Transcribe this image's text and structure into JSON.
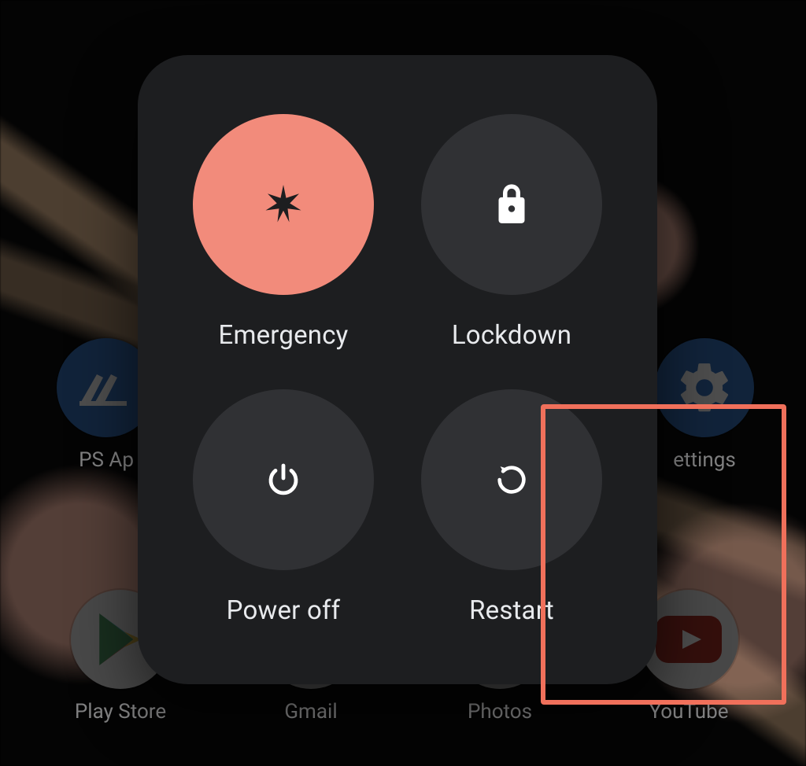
{
  "power_menu": {
    "emergency": {
      "label": "Emergency"
    },
    "lockdown": {
      "label": "Lockdown"
    },
    "power_off": {
      "label": "Power off"
    },
    "restart": {
      "label": "Restart"
    }
  },
  "home_apps": {
    "ps_app": {
      "label": "PS Ap"
    },
    "settings": {
      "label": "ettings"
    },
    "play_store": {
      "label": "Play Store"
    },
    "gmail": {
      "label": "Gmail"
    },
    "photos": {
      "label": "Photos"
    },
    "youtube": {
      "label": "YouTube"
    }
  }
}
